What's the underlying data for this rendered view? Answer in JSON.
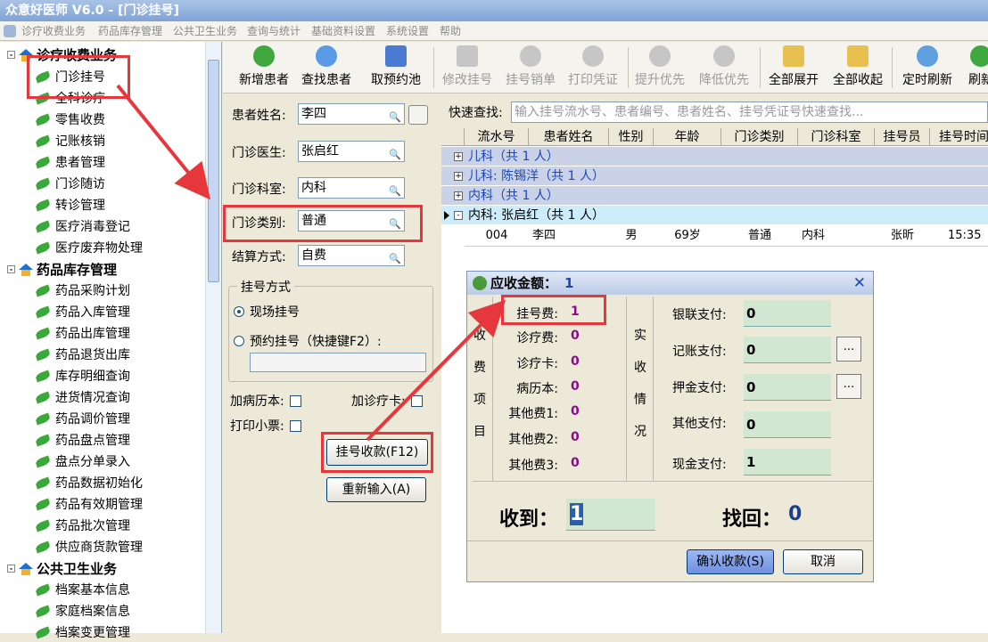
{
  "window": {
    "title": "众意好医师 V6.0 - [门诊挂号]"
  },
  "menu": [
    "诊疗收费业务",
    "药品库存管理",
    "公共卫生业务",
    "查询与统计",
    "基础资料设置",
    "系统设置",
    "帮助"
  ],
  "sidebar": {
    "groups": [
      {
        "label": "诊疗收费业务",
        "items": [
          "门诊挂号",
          "全科诊疗",
          "零售收费",
          "记账核销",
          "患者管理",
          "门诊随访",
          "转诊管理",
          "医疗消毒登记",
          "医疗废弃物处理"
        ]
      },
      {
        "label": "药品库存管理",
        "items": [
          "药品采购计划",
          "药品入库管理",
          "药品出库管理",
          "药品退货出库",
          "库存明细查询",
          "进货情况查询",
          "药品调价管理",
          "药品盘点管理",
          "盘点分单录入",
          "药品数据初始化",
          "药品有效期管理",
          "药品批次管理",
          "供应商货款管理"
        ]
      },
      {
        "label": "公共卫生业务",
        "items": [
          "档案基本信息",
          "家庭档案信息",
          "档案变更管理"
        ]
      }
    ]
  },
  "toolbar": [
    "新增患者",
    "查找患者",
    "取预约池",
    "修改挂号",
    "挂号销单",
    "打印凭证",
    "提升优先",
    "降低优先",
    "全部展开",
    "全部收起",
    "定时刷新",
    "刷新"
  ],
  "form": {
    "patient_name_label": "患者姓名:",
    "patient_name": "李四",
    "doctor_label": "门诊医生:",
    "doctor": "张启红",
    "dept_label": "门诊科室:",
    "dept": "内科",
    "type_label": "门诊类别:",
    "type": "普通",
    "settle_label": "结算方式:",
    "settle": "自费",
    "reg_mode_title": "挂号方式",
    "reg_onsite": "现场挂号",
    "reg_appt": "预约挂号（快捷键F2）:",
    "add_record": "加病历本:",
    "add_card": "加诊疗卡:",
    "print_ticket": "打印小票:",
    "pay_btn": "挂号收款(F12)",
    "reset_btn": "重新输入(A)"
  },
  "grid": {
    "quick_label": "快速查找:",
    "quick_placeholder": "输入挂号流水号、患者编号、患者姓名、挂号凭证号快速查找...",
    "columns": [
      "流水号",
      "患者姓名",
      "性别",
      "年龄",
      "门诊类别",
      "门诊科室",
      "挂号员",
      "挂号时间"
    ],
    "groups": [
      "儿科（共 1 人）",
      "儿科: 陈锡洋（共 1 人）",
      "内科（共 1 人）",
      "内科: 张启红（共 1 人）"
    ],
    "row": [
      "004",
      "李四",
      "男",
      "69岁",
      "普通",
      "内科",
      "张昕",
      "15:35"
    ]
  },
  "dialog": {
    "title_label": "应收金额：",
    "title_amount": "1",
    "left_section": [
      "收",
      "费",
      "项",
      "目"
    ],
    "right_section": [
      "实",
      "收",
      "情",
      "况"
    ],
    "fees": [
      {
        "label": "挂号费:",
        "value": "1"
      },
      {
        "label": "诊疗费:",
        "value": "0"
      },
      {
        "label": "诊疗卡:",
        "value": "0"
      },
      {
        "label": "病历本:",
        "value": "0"
      },
      {
        "label": "其他费1:",
        "value": "0"
      },
      {
        "label": "其他费2:",
        "value": "0"
      },
      {
        "label": "其他费3:",
        "value": "0"
      }
    ],
    "pays": [
      {
        "label": "银联支付:",
        "value": "0"
      },
      {
        "label": "记账支付:",
        "value": "0"
      },
      {
        "label": "押金支付:",
        "value": "0"
      },
      {
        "label": "其他支付:",
        "value": "0"
      },
      {
        "label": "现金支付:",
        "value": "1"
      }
    ],
    "received_label": "收到：",
    "received": "1",
    "change_label": "找回：",
    "change": "0",
    "confirm_btn": "确认收款(S)",
    "cancel_btn": "取消",
    "close": "✕",
    "dots": "..."
  },
  "colors": {
    "annotation": "#e6383c",
    "titlebar": "#7fa3d6"
  }
}
